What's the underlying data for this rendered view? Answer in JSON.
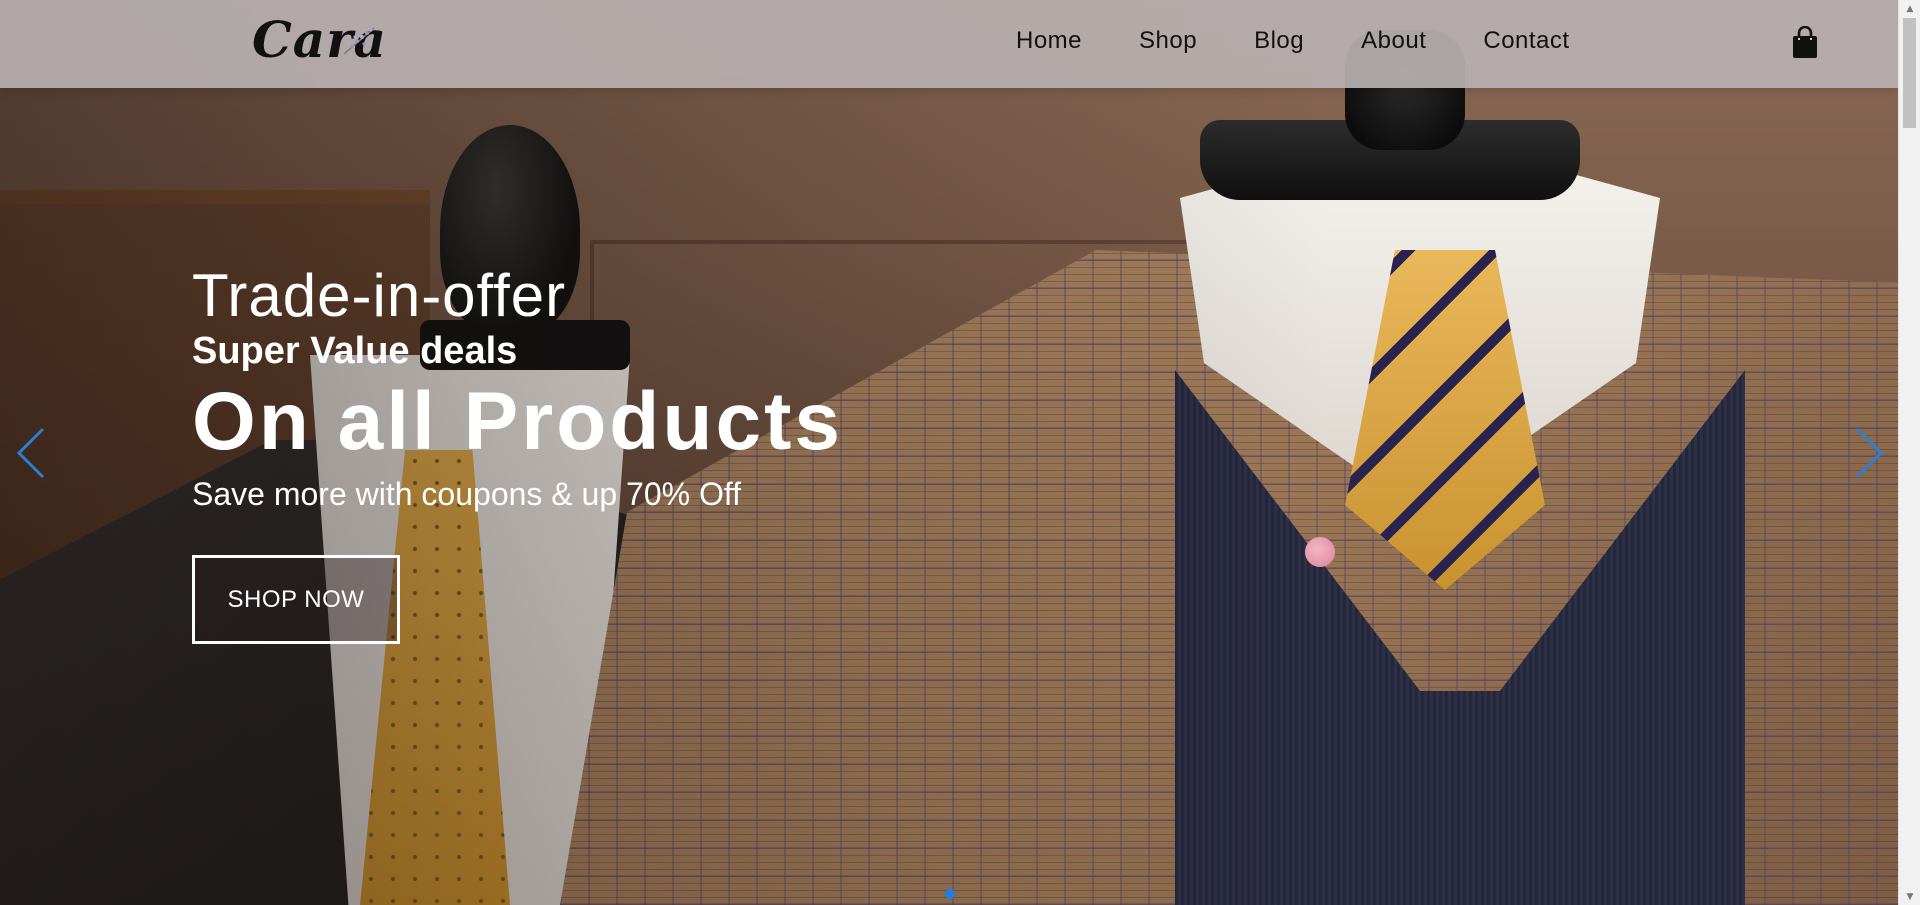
{
  "header": {
    "logo_text": "Cara",
    "nav": [
      {
        "label": "Home"
      },
      {
        "label": "Shop"
      },
      {
        "label": "Blog"
      },
      {
        "label": "About"
      },
      {
        "label": "Contact"
      }
    ],
    "cart_icon": "shopping-bag-icon"
  },
  "hero": {
    "line1": "Trade-in-offer",
    "line2": "Super Value deals",
    "line3": "On all Products",
    "line4": "Save more with coupons & up 70% Off",
    "cta_label": "SHOP NOW",
    "prev_icon": "chevron-left-icon",
    "next_icon": "chevron-right-icon",
    "slides_total": 1,
    "active_slide": 1
  },
  "colors": {
    "header_bg": "#b7afaf",
    "text_on_hero": "#ffffff",
    "accent": "#1f7ee0",
    "nav_text": "#111111"
  }
}
